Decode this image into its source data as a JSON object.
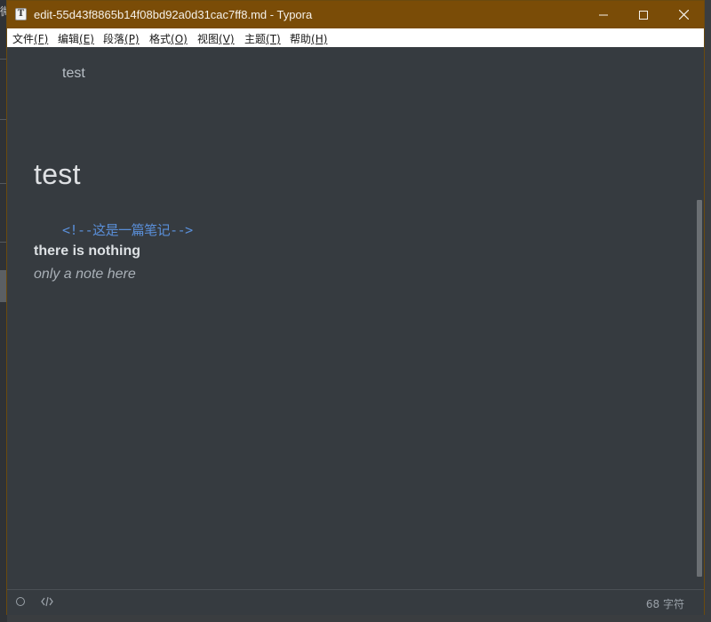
{
  "window": {
    "title": "edit-55d43f8865b14f08bd92a0d31cac7ff8.md - Typora",
    "app_icon_letter": "T"
  },
  "background_app": {
    "edge_glyph": "微"
  },
  "menu": {
    "items": [
      {
        "label": "文件",
        "accel": "(F)"
      },
      {
        "label": "编辑",
        "accel": "(E)"
      },
      {
        "label": "段落",
        "accel": "(P)"
      },
      {
        "label": "格式",
        "accel": "(O)"
      },
      {
        "label": "视图",
        "accel": "(V)"
      },
      {
        "label": "主题",
        "accel": "(T)"
      },
      {
        "label": "帮助",
        "accel": "(H)"
      }
    ]
  },
  "document": {
    "indented_text": "test",
    "heading": "test",
    "comment": "<!--这是一篇笔记-->",
    "bold_text": "there is nothing",
    "italic_text": "only a note here"
  },
  "statusbar": {
    "word_count": "68 字符"
  },
  "colors": {
    "titlebar": "#7a4c07",
    "editor_bg": "#363b40",
    "comment": "#5a8fd9"
  }
}
